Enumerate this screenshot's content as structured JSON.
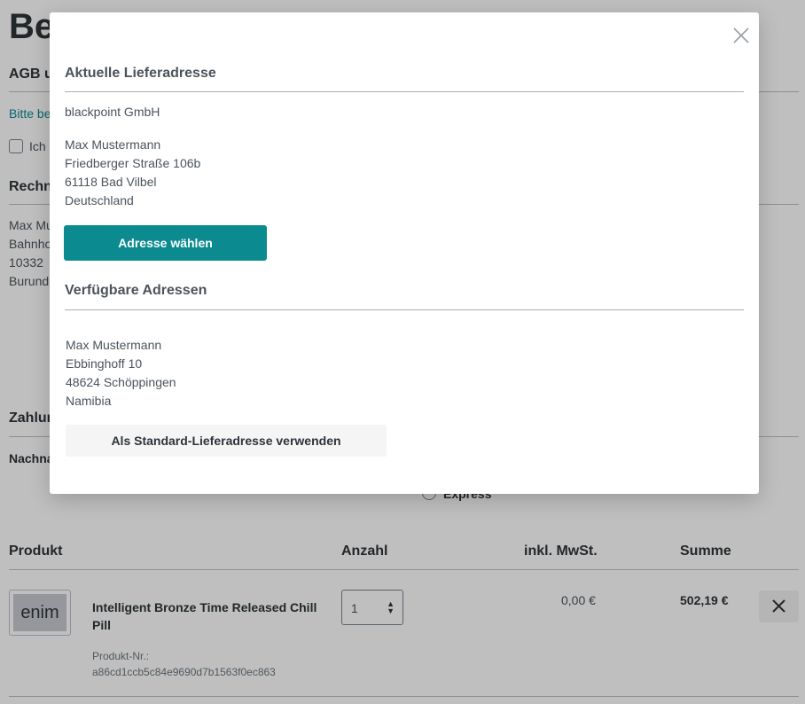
{
  "background": {
    "page_title": "Be",
    "sections": {
      "agb_heading": "AGB u",
      "agb_link": "Bitte be",
      "agb_checkbox_label": "Ich",
      "billing_heading": "Rechn",
      "billing_lines": [
        "Max Mu",
        "Bahnho",
        "10332",
        "Burund"
      ],
      "payment_heading": "Zahlun",
      "payment_method": "Nachna",
      "shipping_option": "Express"
    },
    "table": {
      "headers": {
        "product": "Produkt",
        "quantity": "Anzahl",
        "vat": "inkl. MwSt.",
        "sum": "Summe"
      },
      "rows": [
        {
          "thumb_text": "enim",
          "name": "Intelligent Bronze Time Released Chill Pill",
          "number_label": "Produkt-Nr.:",
          "number": "a86cd1ccb5c84e9690d7b1563f0ec863",
          "quantity": "1",
          "vat": "0,00 €",
          "sum": "502,19 €"
        }
      ]
    }
  },
  "modal": {
    "current_heading": "Aktuelle Lieferadresse",
    "current_company": "blackpoint GmbH",
    "current_address": [
      "Max Mustermann",
      "Friedberger Straße 106b",
      "61118 Bad Vilbel",
      "Deutschland"
    ],
    "select_button": "Adresse wählen",
    "available_heading": "Verfügbare Adressen",
    "available_address": [
      "Max Mustermann",
      "Ebbinghoff 10",
      "48624 Schöppingen",
      "Namibia"
    ],
    "default_button": "Als Standard-Lieferadresse verwenden",
    "close_icon": "close-icon"
  },
  "colors": {
    "accent": "#0b8a8f",
    "overlay": "rgba(0,0,0,0.25)"
  }
}
